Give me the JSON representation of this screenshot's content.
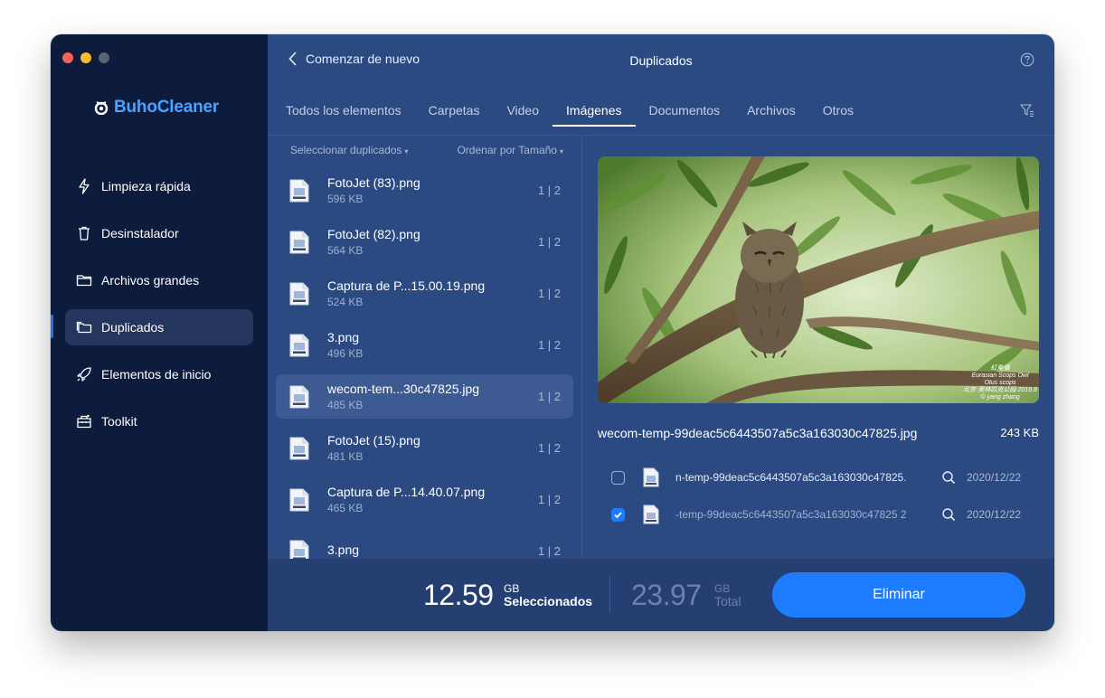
{
  "window": {
    "controls": [
      "close",
      "minimize",
      "zoom"
    ]
  },
  "sidebar": {
    "brand": "BuhoCleaner",
    "items": [
      {
        "label": "Limpieza rápida",
        "icon": "bolt-icon"
      },
      {
        "label": "Desinstalador",
        "icon": "trash-icon"
      },
      {
        "label": "Archivos grandes",
        "icon": "folder-icon"
      },
      {
        "label": "Duplicados",
        "icon": "duplicate-folder-icon",
        "active": true
      },
      {
        "label": "Elementos de inicio",
        "icon": "rocket-icon"
      },
      {
        "label": "Toolkit",
        "icon": "toolkit-icon"
      }
    ]
  },
  "header": {
    "back_label": "Comenzar de nuevo",
    "title": "Duplicados"
  },
  "tabs": [
    {
      "label": "Todos los elementos"
    },
    {
      "label": "Carpetas"
    },
    {
      "label": "Video"
    },
    {
      "label": "Imágenes",
      "active": true
    },
    {
      "label": "Documentos"
    },
    {
      "label": "Archivos"
    },
    {
      "label": "Otros"
    }
  ],
  "list": {
    "select_label": "Seleccionar duplicados",
    "sort_label": "Ordenar por Tamaño",
    "items": [
      {
        "name": "FotoJet (83).png",
        "size": "596 KB",
        "count": "1 | 2"
      },
      {
        "name": "FotoJet (82).png",
        "size": "564 KB",
        "count": "1 | 2"
      },
      {
        "name": "Captura de P...15.00.19.png",
        "size": "524 KB",
        "count": "1 | 2"
      },
      {
        "name": "3.png",
        "size": "496 KB",
        "count": "1 | 2"
      },
      {
        "name": "wecom-tem...30c47825.jpg",
        "size": "485 KB",
        "count": "1 | 2",
        "active": true
      },
      {
        "name": "FotoJet (15).png",
        "size": "481 KB",
        "count": "1 | 2"
      },
      {
        "name": "Captura de P...14.40.07.png",
        "size": "465 KB",
        "count": "1 | 2"
      },
      {
        "name": "3.png",
        "size": "",
        "count": "1 | 2"
      }
    ]
  },
  "preview": {
    "filename": "wecom-temp-99deac5c6443507a5c3a163030c47825.jpg",
    "size": "243 KB",
    "watermark": [
      "紅角鴞",
      "Eurasian Scops Owl",
      "Otus scops",
      "北京·奥林匹克公园 2019.8",
      "© yang zhang"
    ],
    "duplicates": [
      {
        "path": "n-temp-99deac5c6443507a5c3a163030c47825.",
        "date": "2020/12/22",
        "checked": false
      },
      {
        "path": "-temp-99deac5c6443507a5c3a163030c47825 2",
        "date": "2020/12/22",
        "checked": true
      }
    ]
  },
  "footer": {
    "selected_value": "12.59",
    "selected_unit": "GB",
    "selected_label": "Seleccionados",
    "total_value": "23.97",
    "total_unit": "GB",
    "total_label": "Total",
    "delete_label": "Eliminar"
  },
  "colors": {
    "sidebar_bg": "#0d1b3c",
    "main_bg": "#2c4a82",
    "footer_bg": "#253f73",
    "accent": "#1e7cff",
    "brand": "#4aa3ff"
  }
}
